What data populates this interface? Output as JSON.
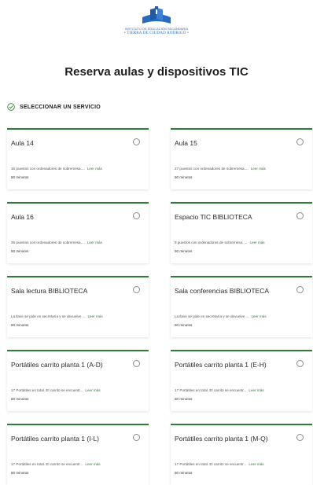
{
  "logo": {
    "line1": "INSTITUTO DE EDUCACIÓN SECUNDARIA",
    "line2": "• TIERRA DE CIUDAD RODRIGO •"
  },
  "page_title": "Reserva aulas y dispositivos TIC",
  "section_label": "SELECCIONAR UN SERVICIO",
  "colors": {
    "accent": "#2e7d32",
    "brand": "#2a6bbf"
  },
  "read_more": "Leer más",
  "services": [
    {
      "name": "Aula 14",
      "desc": "16 puestos con ordenadores de sobremesa....",
      "duration": "50 minutos"
    },
    {
      "name": "Aula 15",
      "desc": "27 puestos con ordenadores de sobremesa....",
      "duration": "50 minutos"
    },
    {
      "name": "Aula 16",
      "desc": "26 puestos con ordenadores de sobremesa....",
      "duration": "50 minutos"
    },
    {
      "name": "Espacio TIC BIBLIOTECA",
      "desc": "9 puestos con ordenadores de sobremesa. ...",
      "duration": "50 minutos"
    },
    {
      "name": "Sala lectura BIBLIOTECA",
      "desc": "La llave se pide en secretaría y se devuelve ...",
      "duration": "50 minutos"
    },
    {
      "name": "Sala conferencias BIBLIOTECA",
      "desc": "La llave se pide en secretaría y se devuelve ...",
      "duration": "50 minutos"
    },
    {
      "name": "Portátiles carrito planta 1 (A-D)",
      "desc": "17 Portátiles en total. El carrito se encuentr...",
      "duration": "50 minutos"
    },
    {
      "name": "Portátiles carrito planta 1 (E-H)",
      "desc": "17 Portátiles en total. El carrito se encuentr...",
      "duration": "50 minutos"
    },
    {
      "name": "Portátiles carrito planta 1 (I-L)",
      "desc": "17 Portátiles en total. El carrito se encuentr...",
      "duration": "50 minutos"
    },
    {
      "name": "Portátiles carrito planta 1 (M-Q)",
      "desc": "17 Portátiles en total. El carrito se encuentr...",
      "duration": "50 minutos"
    }
  ]
}
